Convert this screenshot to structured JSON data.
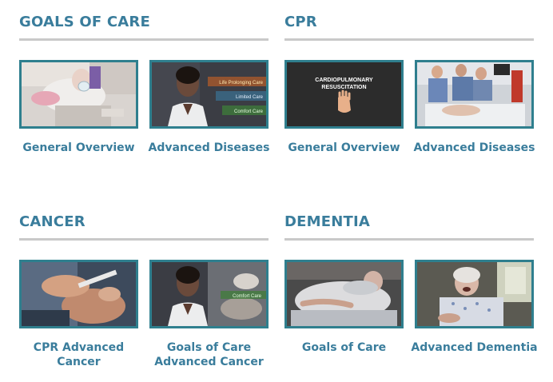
{
  "sections": {
    "goals": {
      "title": "GOALS OF CARE",
      "cards": [
        {
          "caption": [
            "General Overview"
          ],
          "thumb": "elderly-patient-oxygen-mask"
        },
        {
          "caption": [
            "Advanced Diseases"
          ],
          "thumb": "doctor-levels-of-care",
          "overlay": [
            "Life Prolonging Care",
            "Limited Care",
            "Comfort Care"
          ]
        }
      ]
    },
    "cpr": {
      "title": "CPR",
      "cards": [
        {
          "caption": [
            "General Overview"
          ],
          "thumb": "cpr-title-card",
          "overlay": [
            "CARDIOPULMONARY",
            "RESUSCITATION"
          ]
        },
        {
          "caption": [
            "Advanced Diseases"
          ],
          "thumb": "hospital-cpr-team"
        }
      ]
    },
    "cancer": {
      "title": "CANCER",
      "cards": [
        {
          "caption": [
            "CPR Advanced",
            "Cancer"
          ],
          "thumb": "intubation-closeup"
        },
        {
          "caption": [
            "Goals of Care",
            "Advanced Cancer"
          ],
          "thumb": "doctor-comfort-care",
          "overlay": [
            "Comfort Care"
          ]
        }
      ]
    },
    "dementia": {
      "title": "DEMENTIA",
      "cards": [
        {
          "caption": [
            "Goals of Care"
          ],
          "thumb": "patient-in-hospital-bed"
        },
        {
          "caption": [
            "Advanced Dementia"
          ],
          "thumb": "elderly-woman-in-bed"
        }
      ]
    }
  },
  "colors": {
    "accent": "#3a7d9c",
    "thumb_border": "#2f7f8e",
    "rule": "#c9c9c9"
  }
}
